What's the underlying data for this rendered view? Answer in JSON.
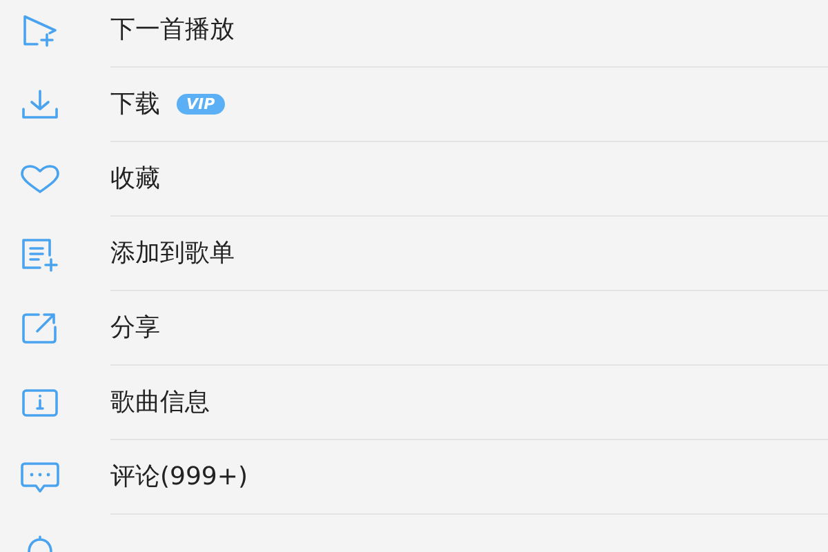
{
  "menu": {
    "items": [
      {
        "kind": "play-next",
        "label": "下一首播放"
      },
      {
        "kind": "download",
        "label": "下载",
        "badge": "VIP"
      },
      {
        "kind": "heart",
        "label": "收藏"
      },
      {
        "kind": "playlist-add",
        "label": "添加到歌单"
      },
      {
        "kind": "share",
        "label": "分享"
      },
      {
        "kind": "info",
        "label": "歌曲信息"
      },
      {
        "kind": "comment",
        "label": "评论(999+)"
      },
      {
        "kind": "bell"
      }
    ]
  }
}
